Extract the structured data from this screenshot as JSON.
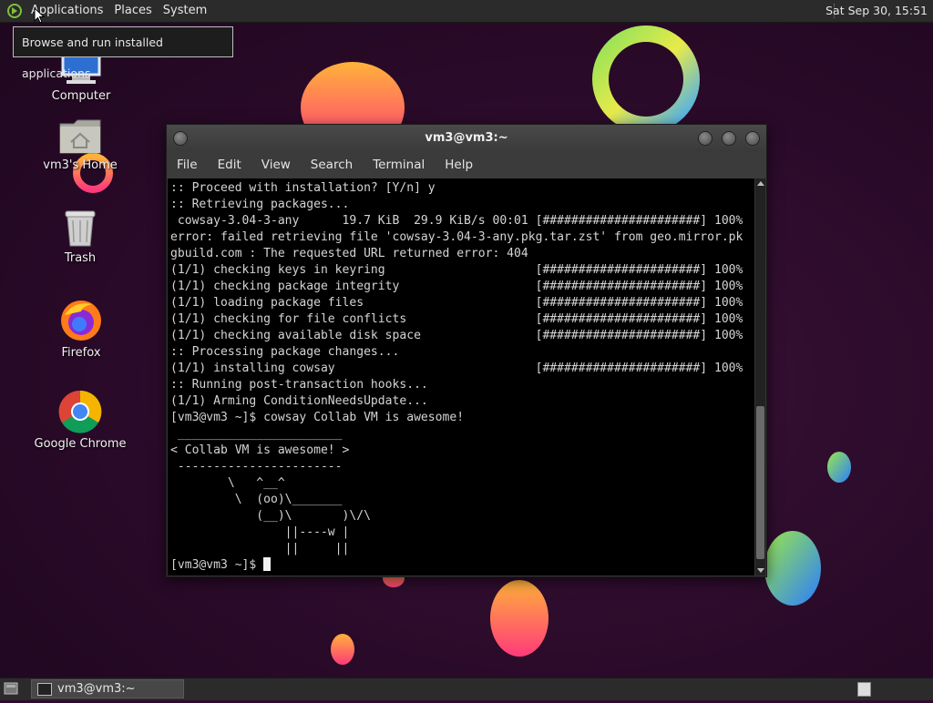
{
  "top_panel": {
    "menus": [
      "Applications",
      "Places",
      "System"
    ],
    "clock": "Sat Sep 30, 15:51",
    "tooltip": "Browse and run installed applications"
  },
  "desktop_icons": [
    {
      "label": "Computer",
      "icon": "computer-icon"
    },
    {
      "label": "vm3's Home",
      "icon": "home-folder-icon"
    },
    {
      "label": "Trash",
      "icon": "trash-icon"
    },
    {
      "label": "Firefox",
      "icon": "firefox-icon"
    },
    {
      "label": "Google Chrome",
      "icon": "chrome-icon"
    }
  ],
  "terminal": {
    "title": "vm3@vm3:~",
    "menus": [
      "File",
      "Edit",
      "View",
      "Search",
      "Terminal",
      "Help"
    ],
    "lines": [
      ":: Proceed with installation? [Y/n] y",
      ":: Retrieving packages...",
      " cowsay-3.04-3-any      19.7 KiB  29.9 KiB/s 00:01 [######################] 100%",
      "error: failed retrieving file 'cowsay-3.04-3-any.pkg.tar.zst' from geo.mirror.pk",
      "gbuild.com : The requested URL returned error: 404",
      "(1/1) checking keys in keyring                     [######################] 100%",
      "(1/1) checking package integrity                   [######################] 100%",
      "(1/1) loading package files                        [######################] 100%",
      "(1/1) checking for file conflicts                  [######################] 100%",
      "(1/1) checking available disk space                [######################] 100%",
      ":: Processing package changes...",
      "(1/1) installing cowsay                            [######################] 100%",
      ":: Running post-transaction hooks...",
      "(1/1) Arming ConditionNeedsUpdate...",
      "[vm3@vm3 ~]$ cowsay Collab VM is awesome!",
      " _______________________",
      "< Collab VM is awesome! >",
      " -----------------------",
      "        \\   ^__^",
      "         \\  (oo)\\_______",
      "            (__)\\       )\\/\\",
      "                ||----w |",
      "                ||     ||"
    ],
    "prompt": "[vm3@vm3 ~]$ "
  },
  "taskbar": {
    "task_label": "vm3@vm3:~"
  }
}
